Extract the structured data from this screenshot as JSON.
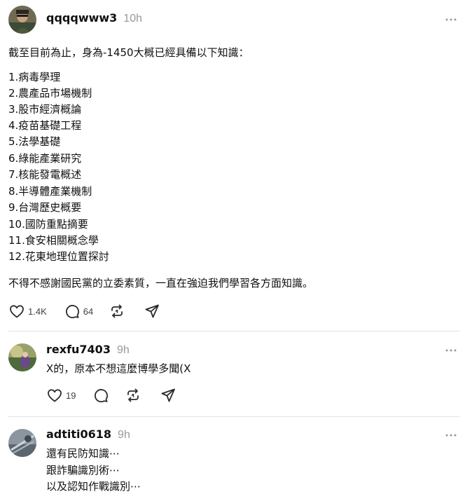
{
  "posts": [
    {
      "username": "qqqqwww3",
      "time": "10h",
      "intro": "截至目前為止，身為-1450大概已經具備以下知識：",
      "list": [
        "1.病毒學理",
        "2.農產品市場機制",
        "3.股市經濟概論",
        "4.疫苗基礎工程",
        "5.法學基礎",
        "6.綠能產業研究",
        "7.核能發電概述",
        "8.半導體產業機制",
        "9.台灣歷史概要",
        "10.國防重點摘要",
        "11.食安相關概念學",
        "12.花東地理位置探討"
      ],
      "outro": "不得不感謝國民黨的立委素質，一直在強迫我們學習各方面知識。",
      "likes": "1.4K",
      "replies": "64"
    },
    {
      "username": "rexfu7403",
      "time": "9h",
      "text": "X的，原本不想這麼博學多聞(X",
      "likes": "19"
    },
    {
      "username": "adtiti0618",
      "time": "9h",
      "lines": [
        "還有民防知識⋯",
        "跟詐騙識別術⋯",
        "以及認知作戰識別⋯"
      ]
    }
  ],
  "icons": {
    "like": "heart-icon",
    "reply": "comment-icon",
    "repost": "repost-icon",
    "share": "share-icon",
    "more": "more-options-icon"
  }
}
